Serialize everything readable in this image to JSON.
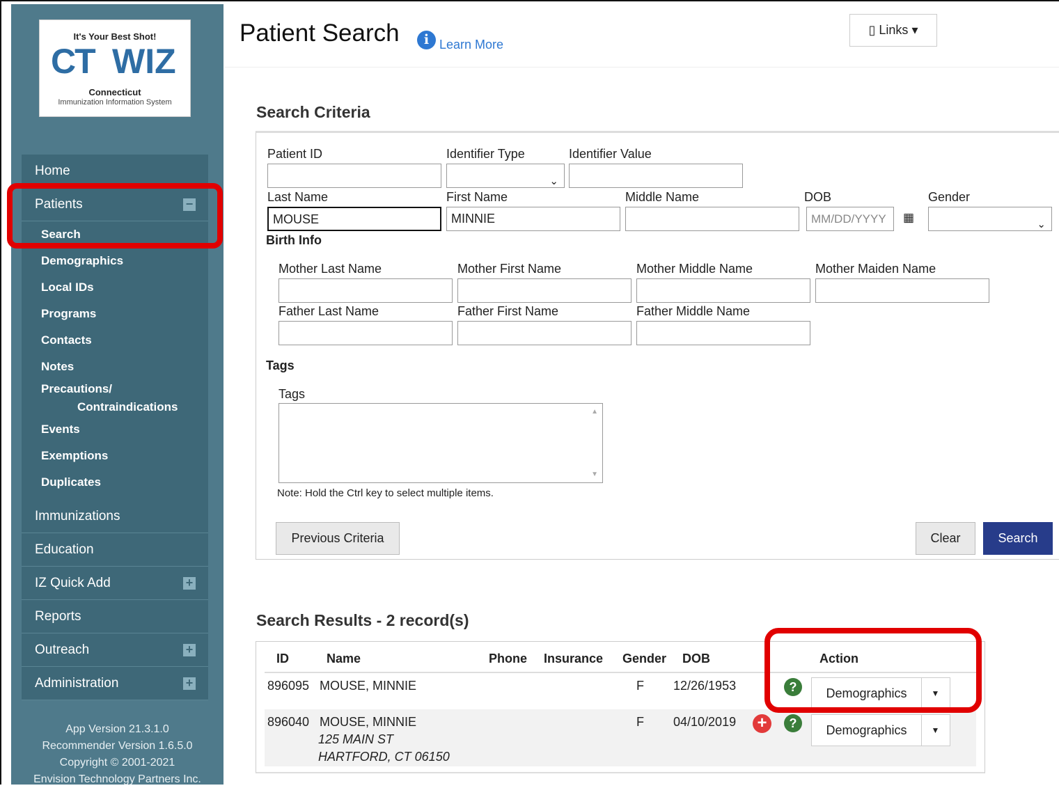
{
  "logo": {
    "tagline": "It's Your Best Shot!",
    "brand_ct": "CT",
    "brand_wiz": "WIZ",
    "state": "Connecticut",
    "system": "Immunization Information System"
  },
  "nav": {
    "home": "Home",
    "patients": "Patients",
    "patients_toggle": "−",
    "patients_sub": [
      "Search",
      "Demographics",
      "Local IDs",
      "Programs",
      "Contacts",
      "Notes"
    ],
    "precautions_1": "Precautions/",
    "precautions_2": "Contraindications",
    "patients_sub2": [
      "Events",
      "Exemptions",
      "Duplicates"
    ],
    "immunizations": "Immunizations",
    "education": "Education",
    "iz_quick_add": "IZ Quick Add",
    "reports": "Reports",
    "outreach": "Outreach",
    "administration": "Administration",
    "expand": "+"
  },
  "version": {
    "app": "App Version 21.3.1.0",
    "recommender": "Recommender Version 1.6.5.0",
    "copyright": "Copyright © 2001-2021",
    "company": "Envision Technology Partners Inc."
  },
  "header": {
    "title": "Patient Search",
    "info_icon": "i",
    "learn_more": "Learn More",
    "links": "Links",
    "links_caret": "▾",
    "links_icon": "▯"
  },
  "search": {
    "title": "Search Criteria",
    "labels": {
      "patient_id": "Patient ID",
      "identifier_type": "Identifier Type",
      "identifier_value": "Identifier Value",
      "last_name": "Last Name",
      "first_name": "First Name",
      "middle_name": "Middle Name",
      "dob": "DOB",
      "gender": "Gender",
      "birth_info": "Birth Info",
      "mother_last": "Mother Last Name",
      "mother_first": "Mother First Name",
      "mother_middle": "Mother Middle Name",
      "mother_maiden": "Mother Maiden Name",
      "father_last": "Father Last Name",
      "father_first": "Father First Name",
      "father_middle": "Father Middle Name",
      "tags_section": "Tags",
      "tags": "Tags"
    },
    "values": {
      "last_name": "MOUSE",
      "first_name": "MINNIE"
    },
    "placeholders": {
      "dob": "MM/DD/YYYY"
    },
    "note": "Note: Hold the Ctrl key to select multiple items.",
    "buttons": {
      "previous": "Previous Criteria",
      "clear": "Clear",
      "search": "Search"
    },
    "select_caret": "⌄",
    "calendar_icon": "▦"
  },
  "results": {
    "title": "Search Results - 2 record(s)",
    "headers": {
      "id": "ID",
      "name": "Name",
      "phone": "Phone",
      "insurance": "Insurance",
      "gender": "Gender",
      "dob": "DOB",
      "action": "Action"
    },
    "rows": [
      {
        "id": "896095",
        "name": "MOUSE, MINNIE",
        "gender": "F",
        "dob": "12/26/1953",
        "action": "Demographics"
      },
      {
        "id": "896040",
        "name": "MOUSE, MINNIE",
        "address1": "125 MAIN ST",
        "address2": "HARTFORD, CT 06150",
        "gender": "F",
        "dob": "04/10/2019",
        "action": "Demographics"
      }
    ],
    "q_icon": "?",
    "plus_icon": "+",
    "caret": "▼"
  }
}
